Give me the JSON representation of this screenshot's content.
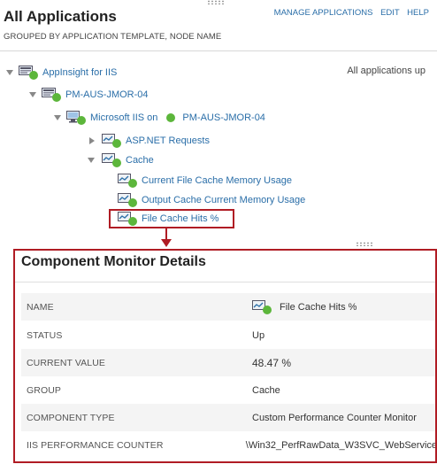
{
  "header": {
    "title": "All Applications",
    "subtitle": "GROUPED BY APPLICATION TEMPLATE, NODE NAME",
    "links": {
      "manage": "MANAGE APPLICATIONS",
      "edit": "EDIT",
      "help": "HELP"
    }
  },
  "summary_status": "All applications up",
  "tree": {
    "template": "AppInsight for IIS",
    "node": "PM-AUS-JMOR-04",
    "app_prefix": "Microsoft IIS on",
    "app_node": "PM-AUS-JMOR-04",
    "components": {
      "aspnet": "ASP.NET Requests",
      "cache": "Cache",
      "cache_children": [
        "Current File Cache Memory Usage",
        "Output Cache Current Memory Usage",
        "File Cache Hits %"
      ]
    }
  },
  "details": {
    "title": "Component Monitor Details",
    "rows": [
      {
        "key": "NAME",
        "value": "File Cache Hits %"
      },
      {
        "key": "STATUS",
        "value": "Up"
      },
      {
        "key": "CURRENT VALUE",
        "value": "48.47 %"
      },
      {
        "key": "GROUP",
        "value": "Cache"
      },
      {
        "key": "COMPONENT TYPE",
        "value": "Custom Performance Counter Monitor"
      },
      {
        "key": "IIS PERFORMANCE COUNTER",
        "value": "\\Win32_PerfRawData_W3SVC_WebService"
      }
    ]
  },
  "colors": {
    "link": "#2a6ea8",
    "status_up": "#5cb63b",
    "highlight": "#b01c24"
  }
}
